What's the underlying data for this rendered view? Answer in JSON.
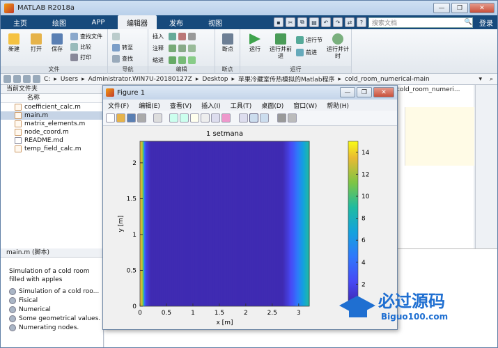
{
  "window": {
    "title": "MATLAB R2018a"
  },
  "tabs": [
    {
      "label": "主页"
    },
    {
      "label": "绘图"
    },
    {
      "label": "APP"
    },
    {
      "label": "编辑器"
    },
    {
      "label": "发布"
    },
    {
      "label": "视图"
    }
  ],
  "search": {
    "placeholder": "搜索文档"
  },
  "login": "登录",
  "ribbon": {
    "file": {
      "label": "文件",
      "new": "新建",
      "open": "打开",
      "save": "保存",
      "find_files": "查找文件",
      "compare": "比较",
      "print": "打印"
    },
    "nav": {
      "label": "导航",
      "goto": "转至",
      "find": "查找"
    },
    "edit": {
      "label": "编辑",
      "insert": "插入",
      "comment": "注释",
      "indent": "缩进"
    },
    "breakpoints": {
      "label": "断点",
      "btn": "断点"
    },
    "run": {
      "label": "运行",
      "run": "运行",
      "run_advance": "运行并前进",
      "run_section": "运行节",
      "advance": "前进",
      "run_time": "运行并计时"
    }
  },
  "address": {
    "crumbs": [
      "C:",
      "Users",
      "Administrator.WIN7U-20180127Z",
      "Desktop",
      "苹果冷藏室传热模拟的Matlab程序",
      "cold_room_numerical-main"
    ]
  },
  "left_panel": {
    "title": "当前文件夹",
    "col": "名称",
    "files": [
      {
        "name": "coefficient_calc.m",
        "selected": false
      },
      {
        "name": "main.m",
        "selected": true
      },
      {
        "name": "matrix_elements.m",
        "selected": false
      },
      {
        "name": "node_coord.m",
        "selected": false
      },
      {
        "name": "README.md",
        "selected": false
      },
      {
        "name": "temp_field_calc.m",
        "selected": false
      }
    ]
  },
  "details": {
    "title": "main.m  (脚本)",
    "desc1": "Simulation of a cold room",
    "desc2": "filled with apples",
    "items": [
      "Simulation of a cold roo...",
      "Fisical",
      "Numerical",
      "Some geometrical values.",
      "Numerating nodes."
    ]
  },
  "editor_path": "\\cold_room_numeri...",
  "figure": {
    "title": "Figure 1",
    "menu": [
      "文件(F)",
      "编辑(E)",
      "查看(V)",
      "插入(I)",
      "工具(T)",
      "桌面(D)",
      "窗口(W)",
      "帮助(H)"
    ]
  },
  "chart_data": {
    "type": "heatmap",
    "title": "1 setmana",
    "xlabel": "x [m]",
    "ylabel": "y [m]",
    "xlim": [
      0,
      3.2
    ],
    "ylim": [
      0,
      2.3
    ],
    "xticks": [
      "0",
      "0.5",
      "1",
      "1.5",
      "2",
      "2.5",
      "3"
    ],
    "yticks": [
      "0",
      "0.5",
      "1",
      "1.5",
      "2"
    ],
    "colorbar_ticks": [
      "0",
      "2",
      "4",
      "6",
      "8",
      "10",
      "12",
      "14"
    ],
    "clim": [
      0,
      15
    ],
    "colormap": "parula",
    "field_description": "low temperature (~0) across interior; high (~15) at left wall x≈0; gradient rising near right edge x>2.7",
    "profile_x": [
      0,
      0.05,
      0.1,
      0.2,
      2.7,
      2.8,
      2.9,
      3.0,
      3.1,
      3.2
    ],
    "profile_t": [
      14,
      12,
      2,
      0.3,
      0.3,
      1.5,
      3,
      5,
      7,
      9
    ]
  },
  "watermark": {
    "text": "必过源码",
    "url": "Biguo100.com"
  }
}
